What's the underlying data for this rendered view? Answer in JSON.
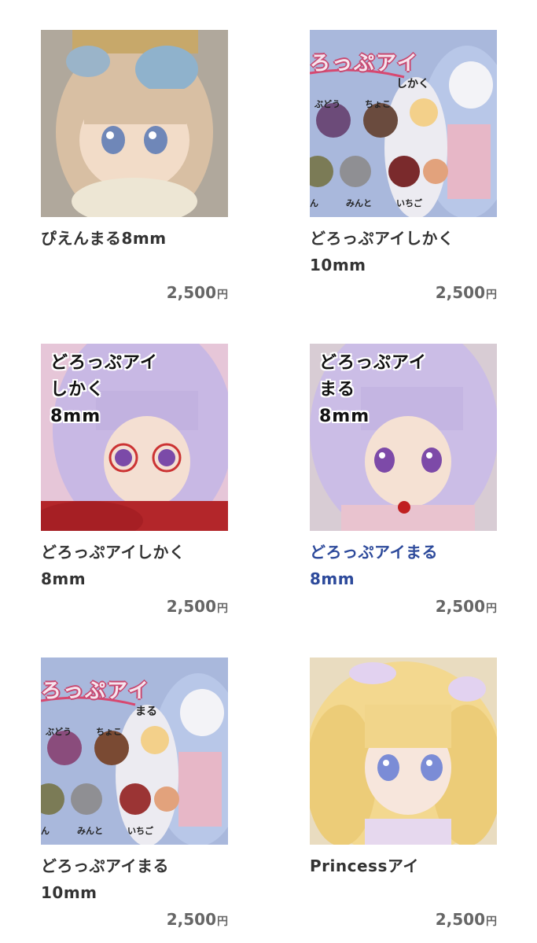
{
  "products": [
    {
      "title": "ぴえんまる8mm",
      "price": "2,500",
      "currency": "円"
    },
    {
      "title": "どろっぷアイしかく\n10mm",
      "price": "2,500",
      "currency": "円",
      "image_text": {
        "banner": "ろっぷアイ",
        "sub": "しかく",
        "labels": [
          "ぶどう",
          "ちょこ",
          "ん",
          "みんと",
          "いちご"
        ]
      }
    },
    {
      "title": "どろっぷアイしかく\n8mm",
      "price": "2,500",
      "currency": "円",
      "image_text": {
        "overlay": "どろっぷアイ\nしかく\n8mm"
      }
    },
    {
      "title": "どろっぷアイまる\n8mm",
      "price": "2,500",
      "currency": "円",
      "image_text": {
        "overlay": "どろっぷアイ\nまる\n8mm"
      }
    },
    {
      "title": "どろっぷアイまる\n10mm",
      "price": "2,500",
      "currency": "円",
      "image_text": {
        "banner": "ろっぷアイ",
        "sub": "まる",
        "labels": [
          "ぶどう",
          "ちょこ",
          "ん",
          "みんと",
          "いちご"
        ]
      }
    },
    {
      "title": "Princessアイ",
      "price": "2,500",
      "currency": "円"
    }
  ],
  "colors": {
    "title": "#333333",
    "title_active": "#2d4a9b",
    "price": "#666666"
  }
}
